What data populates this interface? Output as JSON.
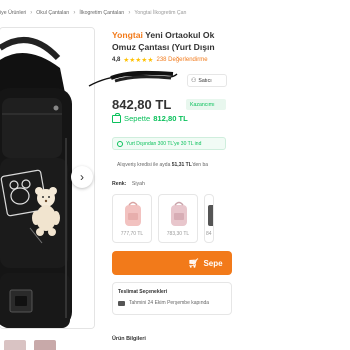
{
  "breadcrumb": {
    "items": [
      "iye Ürünleri",
      "Okul Çantaları",
      "İlkogretim Çantaları",
      "Yongtai İlkogretim Çan"
    ]
  },
  "product": {
    "brand": "Yongtai",
    "title_line1": "Yeni Ortaokul Ok",
    "title_line2": "Omuz Çantası (Yurt Dışın",
    "rating": "4,8",
    "stars": "★★★★★",
    "reviews": "238 Değerlendirme",
    "seller_label": "Satıcı",
    "price": "842,80 TL",
    "badge": "Kazancımı",
    "basket_label": "Sepette",
    "basket_price": "812,80 TL",
    "promo": "Yurt Dışından 300 TL'ye 30 TL ind",
    "credit_prefix": "Alışveriş kredisi ile ayda",
    "credit_amount": "51,31 TL",
    "credit_suffix": "'den ba",
    "color_key": "Renk:",
    "color_value": "Siyah"
  },
  "variants": [
    {
      "price": "777,70 TL",
      "color": "#f2c2c0"
    },
    {
      "price": "783,30 TL",
      "color": "#e8c6cc"
    },
    {
      "price": "84",
      "color": "#555555"
    }
  ],
  "actions": {
    "add_to_cart": "Sepe"
  },
  "delivery": {
    "heading": "Teslimat Seçenekleri",
    "estimate": "Tahmini 24 Ekim Perşembe kapında"
  },
  "section": {
    "info_heading": "Ürün Bilgileri"
  },
  "colors": {
    "brand_orange": "#f27a1a",
    "green": "#0bc15c",
    "star": "#ffc000"
  },
  "icons": [
    "chevron-right-icon",
    "seller-icon",
    "cart-icon",
    "info-icon",
    "truck-icon"
  ]
}
